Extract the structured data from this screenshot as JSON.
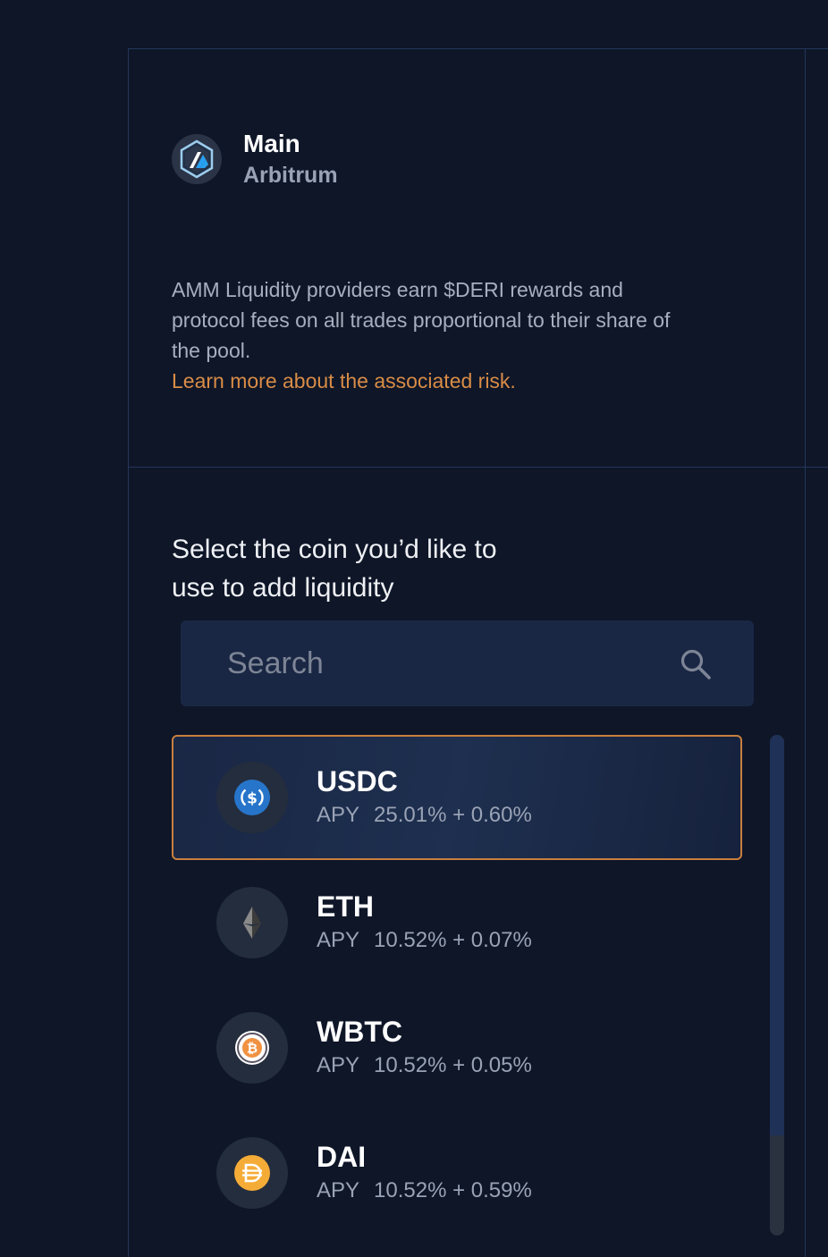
{
  "pool": {
    "name": "Main",
    "chain": "Arbitrum",
    "chain_logo_icon": "arbitrum-logo-icon"
  },
  "description": {
    "text": "AMM Liquidity providers earn $DERI rewards and protocol fees on all trades proportional to their share of the pool.",
    "link": "Learn more about the associated risk."
  },
  "selector": {
    "title": "Select the coin you’d like to use to add liquidity",
    "search_placeholder": "Search",
    "search_value": ""
  },
  "coins": [
    {
      "symbol": "USDC",
      "apy_label": "APY",
      "apy": "25.01% + 0.60%",
      "icon": "usdc-icon",
      "color": "#2775ca",
      "selected": true
    },
    {
      "symbol": "ETH",
      "apy_label": "APY",
      "apy": "10.52% + 0.07%",
      "icon": "eth-icon",
      "color": "#3c3c3d",
      "selected": false
    },
    {
      "symbol": "WBTC",
      "apy_label": "APY",
      "apy": "10.52% + 0.05%",
      "icon": "wbtc-icon",
      "color": "#f09242",
      "selected": false
    },
    {
      "symbol": "DAI",
      "apy_label": "APY",
      "apy": "10.52% + 0.59%",
      "icon": "dai-icon",
      "color": "#f5ac37",
      "selected": false
    }
  ],
  "colors": {
    "background": "#0e1628",
    "accent": "#d98c46",
    "border": "#24365a"
  }
}
